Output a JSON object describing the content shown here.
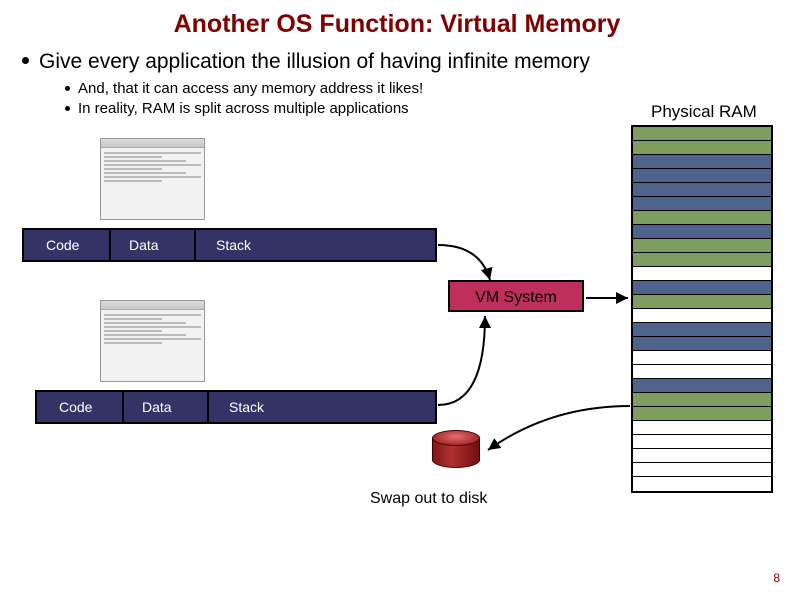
{
  "title": "Another OS Function: Virtual Memory",
  "bullet_main": "Give every application the illusion of having infinite memory",
  "bullet_sub_1": "And, that it can access any memory address it likes!",
  "bullet_sub_2": "In reality, RAM is split across multiple applications",
  "ram_label": "Physical RAM",
  "vm_label": "VM System",
  "swap_label": "Swap out to disk",
  "seg_code": "Code",
  "seg_data": "Data",
  "seg_stack": "Stack",
  "page_number": "8",
  "ram_rows": [
    "g",
    "g",
    "b",
    "b",
    "b",
    "b",
    "g",
    "b",
    "g",
    "g",
    "w",
    "b",
    "g",
    "w",
    "b",
    "b",
    "w",
    "w",
    "b",
    "g",
    "g",
    "w",
    "w",
    "w",
    "w",
    "w"
  ]
}
